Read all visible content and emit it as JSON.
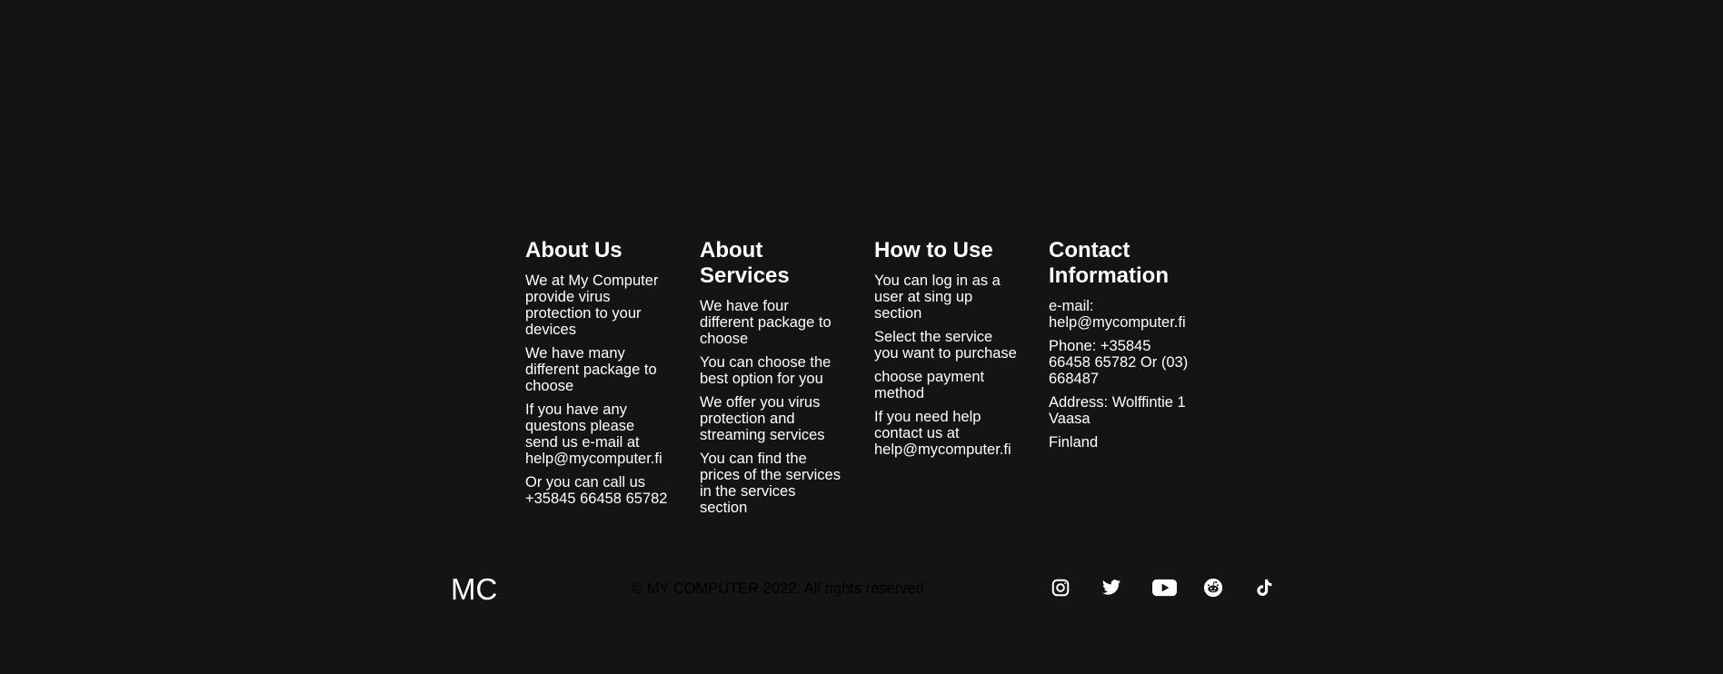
{
  "footer": {
    "columns": [
      {
        "title": "About Us",
        "items": [
          "We at My Computer provide virus protection to your devices",
          "We have many different package to choose",
          "If you have any questons please send us e-mail at help@mycomputer.fi",
          "Or you can call us +35845 66458 65782"
        ]
      },
      {
        "title": "About Services",
        "items": [
          "We have four different package to choose",
          "You can choose the best option for you",
          "We offer you virus protection and streaming services",
          "You can find the prices of the services in the services section"
        ]
      },
      {
        "title": "How to Use",
        "items": [
          "You can log in as a user at sing up section",
          "Select the service you want to purchase",
          "choose payment method",
          "If you need help contact us at help@mycomputer.fi"
        ]
      },
      {
        "title": "Contact Information",
        "items": [
          "e-mail: help@mycomputer.fi",
          "Phone: +35845 66458 65782 Or (03) 668487",
          "Address: Wolffintie 1 Vaasa",
          "Finland"
        ]
      }
    ],
    "logo": "MC",
    "copyright": "© MY COMPUTER 2022. All rights reserved",
    "social": [
      {
        "icon": "instagram-icon"
      },
      {
        "icon": "twitter-icon"
      },
      {
        "icon": "youtube-icon"
      },
      {
        "icon": "reddit-icon"
      },
      {
        "icon": "tiktok-icon"
      }
    ],
    "colors": {
      "background": "#141414",
      "text": "#ffffff",
      "copyright": "#000000"
    }
  }
}
